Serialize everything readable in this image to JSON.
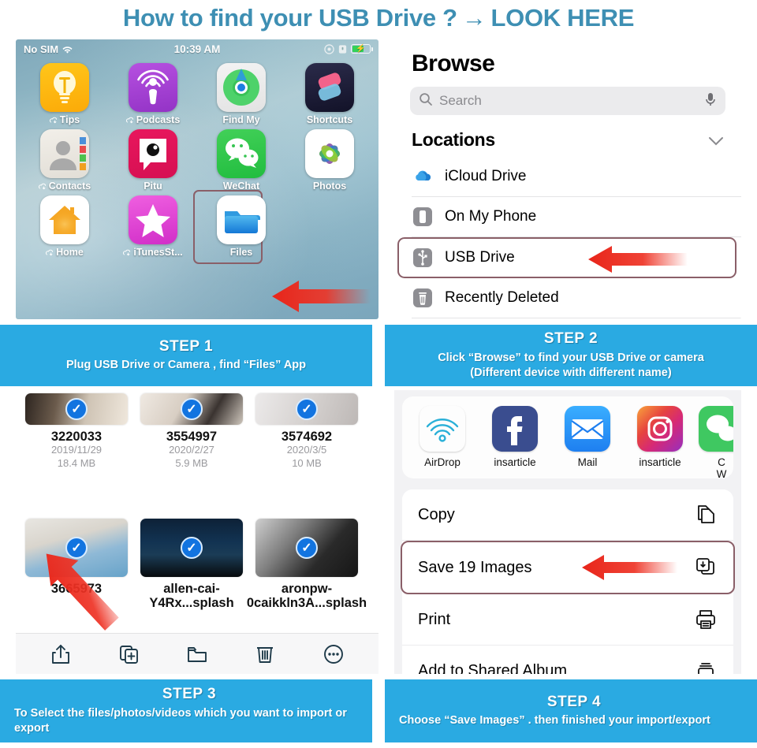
{
  "title": {
    "text_before": "How to find your USB Drive ?",
    "arrow": "→",
    "text_after": "LOOK HERE"
  },
  "colors": {
    "banner_blue": "#2AAAE2",
    "title_blue": "#3E8FB3",
    "highlight_border": "#8A5F68",
    "arrow_red": "#EE3224",
    "check_blue": "#1274E0"
  },
  "phone_home": {
    "status": {
      "carrier": "No SIM",
      "wifi_icon": "wifi-icon",
      "time": "10:39 AM",
      "right_icons": [
        "do-not-disturb-icon",
        "alarm-icon",
        "battery-charging-icon"
      ]
    },
    "apps": [
      [
        {
          "label": "Tips",
          "icon": "tips-icon",
          "cloud": true
        },
        {
          "label": "Podcasts",
          "icon": "podcasts-icon",
          "cloud": true
        },
        {
          "label": "Find My",
          "icon": "find-my-icon",
          "cloud": false
        },
        {
          "label": "Shortcuts",
          "icon": "shortcuts-icon",
          "cloud": false
        }
      ],
      [
        {
          "label": "Contacts",
          "icon": "contacts-icon",
          "cloud": true
        },
        {
          "label": "Pitu",
          "icon": "pitu-icon",
          "cloud": false
        },
        {
          "label": "WeChat",
          "icon": "wechat-icon",
          "cloud": false
        },
        {
          "label": "Photos",
          "icon": "photos-icon",
          "cloud": false
        }
      ],
      [
        {
          "label": "Home",
          "icon": "home-icon",
          "cloud": true
        },
        {
          "label": "iTunesSt...",
          "icon": "itunes-store-icon",
          "cloud": true
        },
        {
          "label": "Files",
          "icon": "files-icon",
          "cloud": false,
          "highlighted": true
        },
        {
          "label": "",
          "icon": "",
          "cloud": false
        }
      ]
    ]
  },
  "browse": {
    "title": "Browse",
    "search": {
      "placeholder": "Search",
      "icon": "search-icon",
      "mic_icon": "microphone-icon"
    },
    "section": {
      "label": "Locations",
      "chevron": "chevron-down-icon"
    },
    "locations": [
      {
        "label": "iCloud Drive",
        "icon": "icloud-drive-icon",
        "highlighted": false
      },
      {
        "label": "On My Phone",
        "icon": "iphone-icon",
        "highlighted": false
      },
      {
        "label": "USB Drive",
        "icon": "usb-icon",
        "highlighted": true
      },
      {
        "label": "Recently Deleted",
        "icon": "trash-icon",
        "highlighted": false
      }
    ]
  },
  "files_grid": {
    "rows": [
      [
        {
          "name": "3220033",
          "date": "2019/11/29",
          "size": "18.4 MB",
          "selected": true
        },
        {
          "name": "3554997",
          "date": "2020/2/27",
          "size": "5.9 MB",
          "selected": true
        },
        {
          "name": "3574692",
          "date": "2020/3/5",
          "size": "10 MB",
          "selected": true
        }
      ],
      [
        {
          "name": "3665973",
          "date": "",
          "size": "",
          "selected": true
        },
        {
          "name": "allen-cai-Y4Rx...splash",
          "date": "",
          "size": "",
          "selected": true
        },
        {
          "name": "aronpw-0caikkln3A...splash",
          "date": "",
          "size": "",
          "selected": true
        }
      ]
    ],
    "toolbar": [
      {
        "icon": "share-icon",
        "label": "Share"
      },
      {
        "icon": "duplicate-icon",
        "label": "Duplicate"
      },
      {
        "icon": "folder-icon",
        "label": "Move to folder"
      },
      {
        "icon": "trash-icon",
        "label": "Delete"
      },
      {
        "icon": "more-icon",
        "label": "More"
      }
    ]
  },
  "share_sheet": {
    "apps": [
      {
        "label": "AirDrop",
        "icon": "airdrop-icon"
      },
      {
        "label": "insarticle",
        "icon": "facebook-icon"
      },
      {
        "label": "Mail",
        "icon": "mail-icon"
      },
      {
        "label": "insarticle",
        "icon": "instagram-icon"
      },
      {
        "label": "C\nW",
        "icon": "wechat-icon"
      }
    ],
    "actions": [
      {
        "label": "Copy",
        "icon": "copy-icon",
        "highlighted": false
      },
      {
        "label": "Save 19 Images",
        "icon": "save-images-icon",
        "highlighted": true
      },
      {
        "label": "Print",
        "icon": "printer-icon",
        "highlighted": false
      },
      {
        "label": "Add to Shared Album",
        "icon": "shared-album-icon",
        "highlighted": false
      }
    ]
  },
  "steps": [
    {
      "step": "STEP 1",
      "desc": "Plug USB Drive or Camera , find “Files” App"
    },
    {
      "step": "STEP 2",
      "desc": "Click “Browse” to find your USB Drive or camera\n(Different device with different name)"
    },
    {
      "step": "STEP 3",
      "desc": "To Select the files/photos/videos which you want to import or export"
    },
    {
      "step": "STEP 4",
      "desc": "Choose “Save Images” . then finished your import/export"
    }
  ]
}
